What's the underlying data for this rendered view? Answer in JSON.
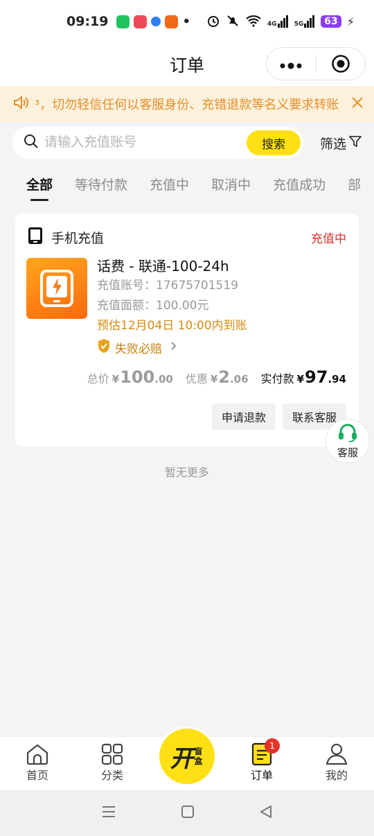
{
  "status_bar": {
    "time": "09:19",
    "network_4g": "4G",
    "network_5g": "5G",
    "battery": "63"
  },
  "navbar": {
    "title": "订单",
    "more_icon": "more-dots-icon",
    "target_icon": "miniapp-close-icon"
  },
  "notice": {
    "text": "³，切勿轻信任何以客服身份、充错退款等名义要求转账",
    "speaker_icon": "speaker-icon",
    "close_icon": "close-icon"
  },
  "search": {
    "placeholder": "请输入充值账号",
    "button_label": "搜索",
    "filter_label": "筛选"
  },
  "tabs": [
    {
      "label": "全部",
      "active": true
    },
    {
      "label": "等待付款",
      "active": false
    },
    {
      "label": "充值中",
      "active": false
    },
    {
      "label": "取消中",
      "active": false
    },
    {
      "label": "充值成功",
      "active": false
    },
    {
      "label": "部",
      "active": false
    }
  ],
  "order": {
    "category": "手机充值",
    "status": "充值中",
    "title": "话费 - 联通-100-24h",
    "account_line": "充值账号：17675701519",
    "amount_line": "充值面额：100.00元",
    "eta": "预估12月04日 10:00内到账",
    "guarantee": "失败必赔",
    "total_label": "总价",
    "total_int": "100",
    "total_dec": ".00",
    "discount_label": "优惠",
    "discount_int": "2",
    "discount_dec": ".06",
    "paid_label": "实付款",
    "paid_int": "97",
    "paid_dec": ".94",
    "currency": "¥",
    "refund_button": "申请退款",
    "contact_button": "联系客服"
  },
  "kefu_label": "客服",
  "no_more": "暂无更多",
  "tabbar": {
    "home": "首页",
    "category": "分类",
    "center_main": "开",
    "center_sub": "盲盒",
    "orders": "订单",
    "orders_badge": "1",
    "mine": "我的"
  },
  "colors": {
    "brand_yellow": "#ffe014",
    "status_red": "#d7322c",
    "notice_orange": "#e48e2a",
    "eta_orange": "#d48a14"
  }
}
